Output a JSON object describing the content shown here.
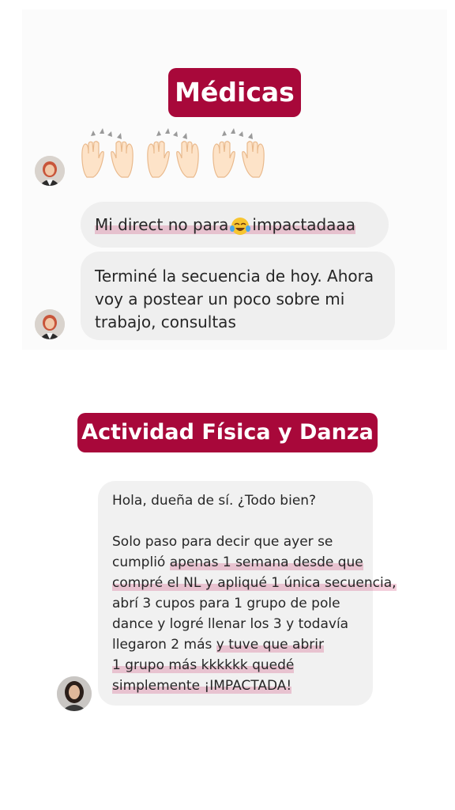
{
  "section1": {
    "label": "Médicas",
    "emoji_reaction": "raised-hands-x3",
    "messages": {
      "m1_before": "Mi direct no para",
      "m1_emoji": "tears-of-joy-emoji",
      "m1_after": "impactadaaa",
      "m2_lines": [
        "Terminé la secuencia de hoy. Ahora",
        "voy a postear un poco sobre mi",
        "trabajo, consultas"
      ]
    }
  },
  "section2": {
    "label": "Actividad Física y Danza",
    "message": {
      "l1": "Hola, dueña de sí. ¿Todo bien?",
      "l2": "Solo paso para decir que ayer se",
      "l3a": "cumplió ",
      "l3b": "apenas 1 semana desde que",
      "l4": "compré el NL y apliqué 1 única secuencia,",
      "l5": "abrí 3 cupos para 1 grupo de pole",
      "l6": "dance y logré llenar los 3 y todavía",
      "l7a": "llegaron 2 más ",
      "l7b": "y tuve que abrir",
      "l8": "1 grupo más kkkkkk quedé",
      "l9": "simplemente ¡IMPACTADA!"
    }
  },
  "colors": {
    "label_bg": "#a8083a",
    "bubble_bg": "#efefef",
    "highlight": "#e8b5c8"
  }
}
